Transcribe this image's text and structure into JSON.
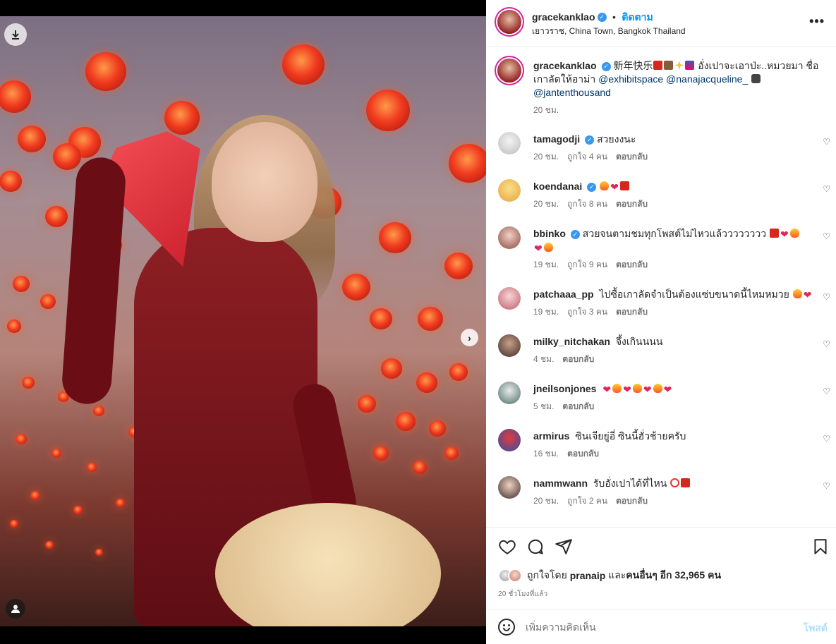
{
  "header": {
    "username": "gracekanklao",
    "follow_label": "ติดตาม",
    "location": "เยาวราช, China Town, Bangkok Thailand",
    "more_label": "•••"
  },
  "caption": {
    "username": "gracekanklao",
    "text_a": "新年快乐",
    "text_b": "อั่งเปาจะเอาป่ะ..หมวยมา ชื่อเกาลัดให้อาม่า",
    "mention_1": "@exhibitspace",
    "mention_2": "@nanajacqueline_",
    "mention_3": "@jantenthousand",
    "time": "20 ชม."
  },
  "comments": [
    {
      "username": "tamagodji",
      "verified": true,
      "text": "สวยงงนะ",
      "time": "20 ชม.",
      "likes": "ถูกใจ 4 คน",
      "reply": "ตอบกลับ"
    },
    {
      "username": "koendanai",
      "verified": true,
      "text": "",
      "time": "20 ชม.",
      "likes": "ถูกใจ 8 คน",
      "reply": "ตอบกลับ"
    },
    {
      "username": "bbinko",
      "verified": true,
      "text": "สวยจนตามชมทุกโพสต์ไม่ไหวแล้วววววววว",
      "time": "19 ชม.",
      "likes": "ถูกใจ 9 คน",
      "reply": "ตอบกลับ"
    },
    {
      "username": "patchaaa_pp",
      "verified": false,
      "text": "ไปซื้อเกาลัดจำเป็นต้องแซ่บขนาดนี้ไหมหมวย",
      "time": "19 ชม.",
      "likes": "ถูกใจ 3 คน",
      "reply": "ตอบกลับ"
    },
    {
      "username": "milky_nitchakan",
      "verified": false,
      "text": "จึ้งเกินนนน",
      "time": "4 ชม.",
      "likes": "",
      "reply": "ตอบกลับ"
    },
    {
      "username": "jneilsonjones",
      "verified": false,
      "text": "",
      "time": "5 ชม.",
      "likes": "",
      "reply": "ตอบกลับ"
    },
    {
      "username": "armirus",
      "verified": false,
      "text": "ซินเจียยู่อี่ ซินนี้ฮั่วช้ายครับ",
      "time": "16 ชม.",
      "likes": "",
      "reply": "ตอบกลับ"
    },
    {
      "username": "nammwann",
      "verified": false,
      "text": "รับอั่งเปาได้ที่ไหน",
      "time": "20 ชม.",
      "likes": "ถูกใจ 2 คน",
      "reply": "ตอบกลับ"
    }
  ],
  "likes_summary": {
    "prefix": "ถูกใจโดย",
    "user": "pranaip",
    "middle": "และ",
    "others": "คนอื่นๆ อีก 32,965 คน"
  },
  "posted_ago": "20 ชั่วโมงที่แล้ว",
  "add_comment": {
    "placeholder": "เพิ่มความคิดเห็น",
    "post_label": "โพสต์"
  },
  "carousel": {
    "slide_count": 12,
    "active_index": 0
  },
  "colors": {
    "accent": "#0095f6",
    "verified": "#3897f0",
    "story_ring": "#d6249f"
  },
  "icons": [
    "download-icon",
    "next-arrow-icon",
    "person-tag-icon",
    "more-icon",
    "verified-icon",
    "heart-icon",
    "comment-icon",
    "share-icon",
    "bookmark-icon",
    "emoji-icon"
  ]
}
